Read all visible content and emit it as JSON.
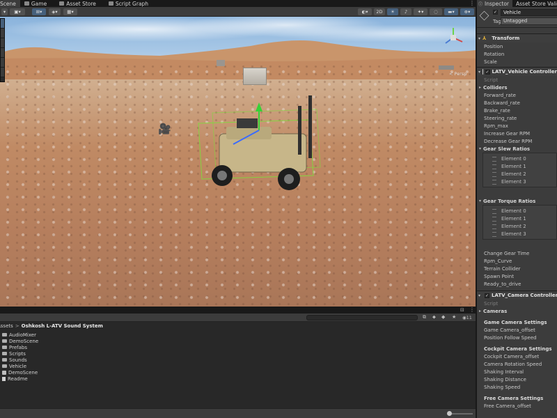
{
  "tabs": [
    {
      "label": "Scene",
      "active": true
    },
    {
      "label": "Game",
      "active": false
    },
    {
      "label": "Asset Store",
      "active": false
    },
    {
      "label": "Script Graph",
      "active": false
    }
  ],
  "scene_toolbar": {
    "mode_2d": "2D"
  },
  "viewport": {
    "gizmo_label": "< Persp"
  },
  "project": {
    "search_count": "11",
    "breadcrumb": {
      "root": "Assets",
      "separator": ">",
      "current": "Oshkosh L-ATV Sound System"
    },
    "items": [
      {
        "name": "AudioMixer",
        "kind": "folder"
      },
      {
        "name": "DemoScene",
        "kind": "folder"
      },
      {
        "name": "Prefabs",
        "kind": "folder"
      },
      {
        "name": "Scripts",
        "kind": "folder"
      },
      {
        "name": "Sounds",
        "kind": "folder"
      },
      {
        "name": "Vehicle",
        "kind": "folder"
      },
      {
        "name": "DemoScene",
        "kind": "scene"
      },
      {
        "name": "Readme",
        "kind": "document"
      }
    ]
  },
  "inspector": {
    "tabs": [
      {
        "label": "Inspector",
        "active": true
      },
      {
        "label": "Asset Store Validator",
        "active": false
      }
    ],
    "gameobject": {
      "name": "Vehicle",
      "tag_label": "Tag",
      "tag_value": "Untagged"
    },
    "transform": {
      "title": "Transform",
      "props": [
        "Position",
        "Rotation",
        "Scale"
      ]
    },
    "vehicle_controller": {
      "title": "LATV_Vehicle Controller",
      "script_label": "Script",
      "colliders": "Colliders",
      "props": [
        "Forward_rate",
        "Backward_rate",
        "Brake_rate",
        "Steering_rate",
        "Rpm_max",
        "Increase Gear RPM",
        "Decrease Gear RPM"
      ],
      "gear_slew": {
        "title": "Gear Slew Ratios",
        "elements": [
          "Element 0",
          "Element 1",
          "Element 2",
          "Element 3"
        ]
      },
      "gear_torque": {
        "title": "Gear Torque Ratios",
        "elements": [
          "Element 0",
          "Element 1",
          "Element 2",
          "Element 3"
        ]
      },
      "props2": [
        "Change Gear Time",
        "Rpm_Curve",
        "Terrain Collider",
        "Spawn Point",
        "Ready_to_drive"
      ]
    },
    "camera_controller": {
      "title": "LATV_Camera Controller",
      "script_label": "Script",
      "cameras": "Cameras",
      "game_section": "Game Camera Settings",
      "game_props": [
        "Game Camera_offset",
        "Position Follow Speed"
      ],
      "cockpit_section": "Cockpit Camera Settings",
      "cockpit_props": [
        "Cockpit Camera_offset",
        "Camera Rotation Speed",
        "Shaking Interval",
        "Shaking Distance",
        "Shaking Speed"
      ],
      "free_section": "Free Camera Settings",
      "free_props": [
        "Free Camera_offset"
      ]
    }
  }
}
